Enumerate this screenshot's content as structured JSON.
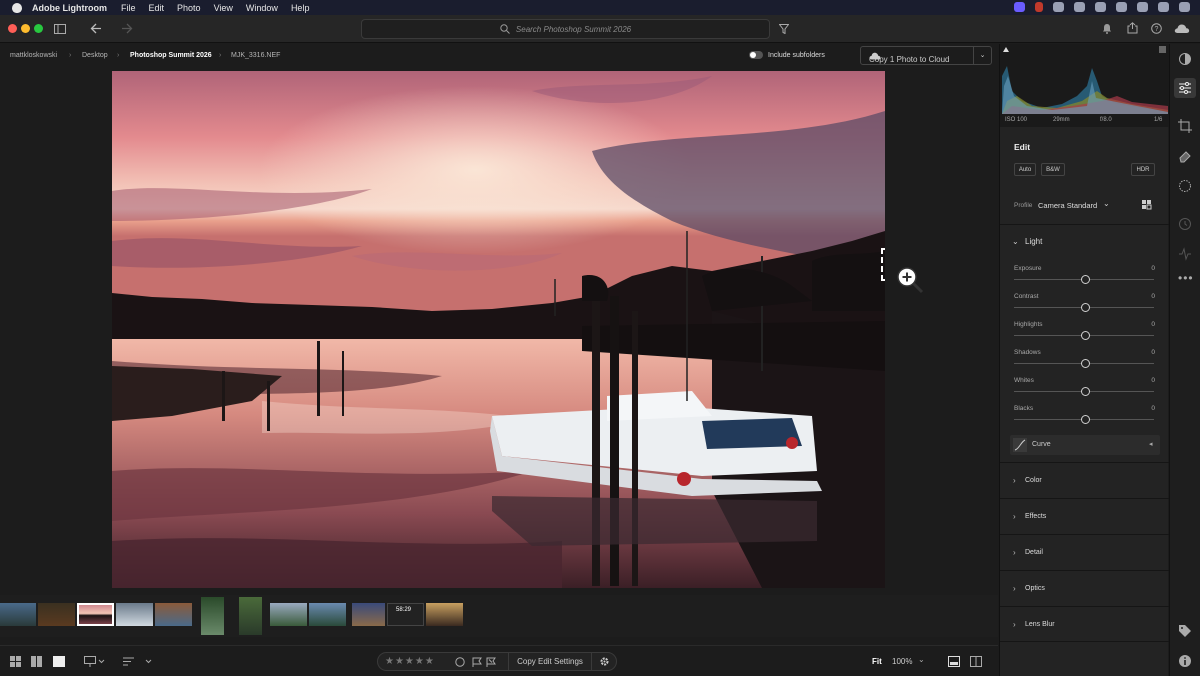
{
  "menubar": {
    "app_name": "Adobe Lightroom",
    "items": [
      "File",
      "Edit",
      "Photo",
      "View",
      "Window",
      "Help"
    ]
  },
  "toolbar": {
    "search_placeholder": "Search Photoshop Summit 2026"
  },
  "breadcrumb": {
    "items": [
      "mattkloskowski",
      "Desktop",
      "Photoshop Summit 2026",
      "MJK_3316.NEF"
    ],
    "subfolders_label": "Include subfolders",
    "copy_cloud_label": "Copy 1 Photo to Cloud"
  },
  "histogram_info": {
    "iso": "ISO 100",
    "focal": "29mm",
    "aperture": "f/8.0",
    "shutter": "1/6"
  },
  "edit_panel": {
    "title": "Edit",
    "auto_label": "Auto",
    "bw_label": "B&W",
    "hdr_label": "HDR",
    "profile_label": "Profile",
    "profile_value": "Camera Standard",
    "light_title": "Light",
    "sliders": [
      {
        "label": "Exposure",
        "value": "0"
      },
      {
        "label": "Contrast",
        "value": "0"
      },
      {
        "label": "Highlights",
        "value": "0"
      },
      {
        "label": "Shadows",
        "value": "0"
      },
      {
        "label": "Whites",
        "value": "0"
      },
      {
        "label": "Blacks",
        "value": "0"
      }
    ],
    "curve_label": "Curve",
    "sections": [
      "Color",
      "Effects",
      "Detail",
      "Optics",
      "Lens Blur"
    ]
  },
  "filmstrip": {
    "video_duration": "58:29"
  },
  "bottombar": {
    "copy_edit_label": "Copy Edit Settings",
    "fit_label": "Fit",
    "zoom_value": "100%",
    "stars": "★★★★★"
  },
  "colors": {
    "accent": "#6a5cff",
    "panel_bg": "#232323",
    "sky_pink": "#e8889a",
    "sky_glow": "#f6d2c8"
  }
}
